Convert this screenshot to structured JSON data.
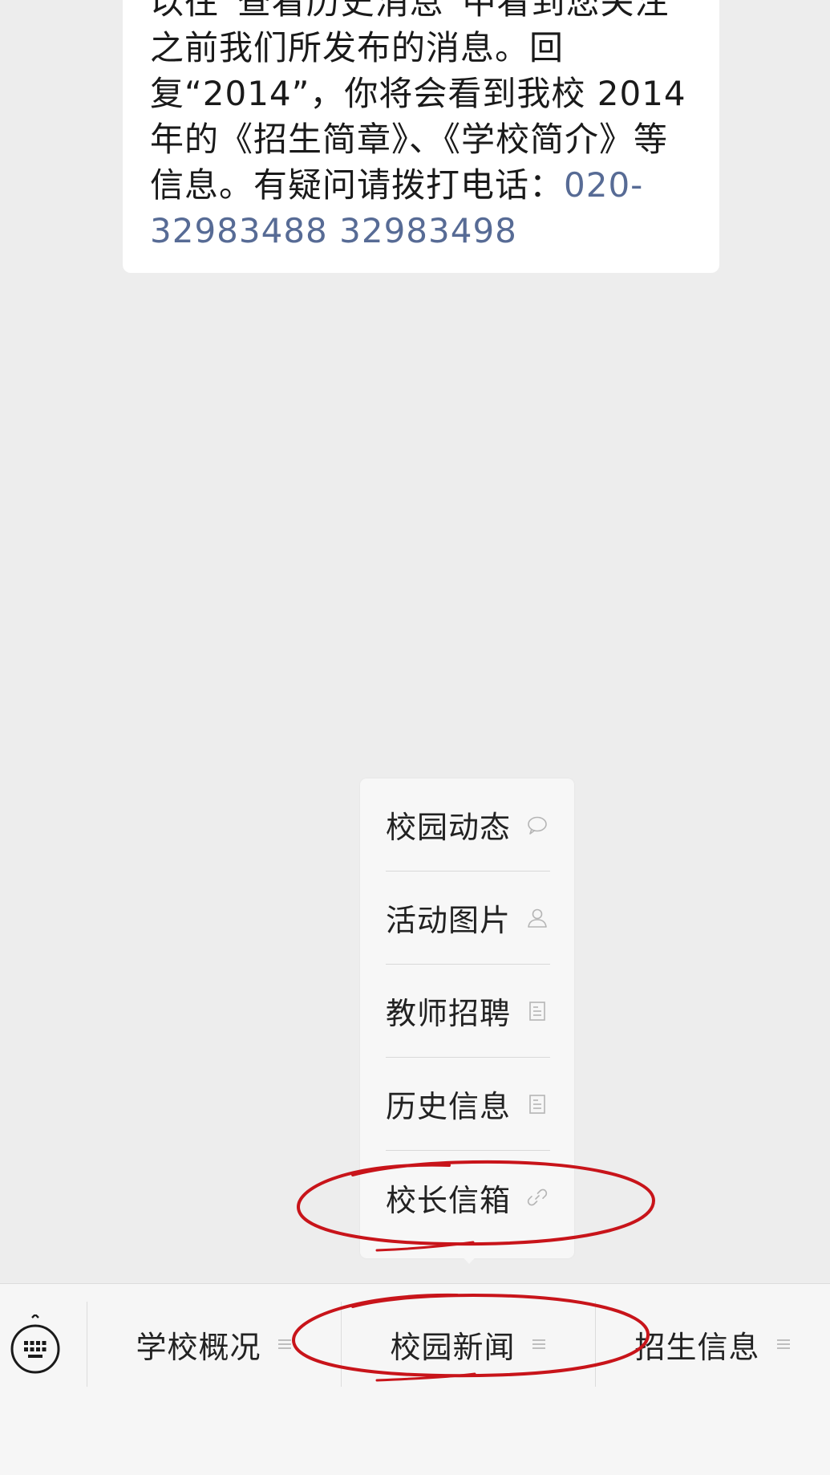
{
  "message": {
    "text_before_phone": "以往“查看历史消息”中看到您关注之前我们所发布的消息。回复“2014”，你将会看到我校 2014 年的《招生简章》、《学校简介》等信息。有疑问请拨打电话：",
    "phone_numbers": "020-32983488  32983498"
  },
  "submenu": {
    "items": [
      {
        "label": "校园动态",
        "icon": "chat-bubble-icon"
      },
      {
        "label": "活动图片",
        "icon": "person-icon"
      },
      {
        "label": "教师招聘",
        "icon": "document-icon"
      },
      {
        "label": "历史信息",
        "icon": "document-icon"
      },
      {
        "label": "校长信箱",
        "icon": "link-icon"
      }
    ]
  },
  "bottom_menu": {
    "keyboard_icon": "keyboard-icon",
    "tabs": [
      {
        "label": "学校概况",
        "icon": "menu-lines-icon"
      },
      {
        "label": "校园新闻",
        "icon": "menu-lines-icon"
      },
      {
        "label": "招生信息",
        "icon": "menu-lines-icon"
      }
    ]
  },
  "colors": {
    "background": "#ededed",
    "bubble": "#ffffff",
    "link": "#576b95",
    "annotation": "#c8141a",
    "bar": "#f6f6f6"
  }
}
